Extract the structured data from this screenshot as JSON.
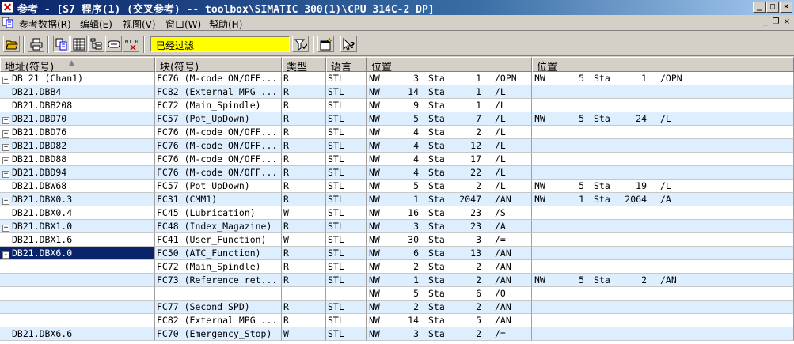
{
  "window": {
    "title": "参考 - [S7 程序(1) (交叉参考) -- toolbox\\SIMATIC 300(1)\\CPU 314C-2 DP]",
    "minimize_label": "_",
    "maximize_label": "□",
    "mdi_minimize_label": "_",
    "mdi_restore_label": "❐",
    "mdi_close_label": "×"
  },
  "menu": [
    {
      "label": "参考数据(R)"
    },
    {
      "label": "编辑(E)"
    },
    {
      "label": "视图(V)"
    },
    {
      "label": "窗口(W)"
    },
    {
      "label": "帮助(H)"
    }
  ],
  "toolbar": {
    "filter_value": "已经过滤",
    "icons": [
      "open-icon",
      "print-icon",
      "cross-reference-icon",
      "assignment-icon",
      "program-structure-icon",
      "unused-symbols-icon",
      "address-without-symbol-icon",
      "filter-icon",
      "new-window-icon",
      "help-icon"
    ]
  },
  "columns": [
    "地址(符号)",
    "块(符号)",
    "类型",
    "语言",
    "位置",
    "位置"
  ],
  "sort_indicator": "▲",
  "rows": [
    {
      "addr": "DB 21 (Chan1)",
      "expand": "+",
      "block": "FC76 (M-code ON/OFF...",
      "type": "R",
      "lang": "STL",
      "loc1": [
        "NW",
        "3",
        "Sta",
        "1",
        "/OPN"
      ],
      "loc2": [
        "NW",
        "5",
        "Sta",
        "1",
        "/OPN"
      ],
      "alt": false,
      "selected": false
    },
    {
      "addr": "DB21.DBB4",
      "expand": "",
      "block": "FC82 (External MPG ...",
      "type": "R",
      "lang": "STL",
      "loc1": [
        "NW",
        "14",
        "Sta",
        "1",
        "/L"
      ],
      "loc2": null,
      "alt": true,
      "selected": false
    },
    {
      "addr": "DB21.DBB208",
      "expand": "",
      "block": "FC72 (Main_Spindle)",
      "type": "R",
      "lang": "STL",
      "loc1": [
        "NW",
        "9",
        "Sta",
        "1",
        "/L"
      ],
      "loc2": null,
      "alt": false,
      "selected": false
    },
    {
      "addr": "DB21.DBD70",
      "expand": "+",
      "block": "FC57 (Pot_UpDown)",
      "type": "R",
      "lang": "STL",
      "loc1": [
        "NW",
        "5",
        "Sta",
        "7",
        "/L"
      ],
      "loc2": [
        "NW",
        "5",
        "Sta",
        "24",
        "/L"
      ],
      "alt": true,
      "selected": false
    },
    {
      "addr": "DB21.DBD76",
      "expand": "+",
      "block": "FC76 (M-code ON/OFF...",
      "type": "R",
      "lang": "STL",
      "loc1": [
        "NW",
        "4",
        "Sta",
        "2",
        "/L"
      ],
      "loc2": null,
      "alt": false,
      "selected": false
    },
    {
      "addr": "DB21.DBD82",
      "expand": "+",
      "block": "FC76 (M-code ON/OFF...",
      "type": "R",
      "lang": "STL",
      "loc1": [
        "NW",
        "4",
        "Sta",
        "12",
        "/L"
      ],
      "loc2": null,
      "alt": true,
      "selected": false
    },
    {
      "addr": "DB21.DBD88",
      "expand": "+",
      "block": "FC76 (M-code ON/OFF...",
      "type": "R",
      "lang": "STL",
      "loc1": [
        "NW",
        "4",
        "Sta",
        "17",
        "/L"
      ],
      "loc2": null,
      "alt": false,
      "selected": false
    },
    {
      "addr": "DB21.DBD94",
      "expand": "+",
      "block": "FC76 (M-code ON/OFF...",
      "type": "R",
      "lang": "STL",
      "loc1": [
        "NW",
        "4",
        "Sta",
        "22",
        "/L"
      ],
      "loc2": null,
      "alt": true,
      "selected": false
    },
    {
      "addr": "DB21.DBW68",
      "expand": "",
      "block": "FC57 (Pot_UpDown)",
      "type": "R",
      "lang": "STL",
      "loc1": [
        "NW",
        "5",
        "Sta",
        "2",
        "/L"
      ],
      "loc2": [
        "NW",
        "5",
        "Sta",
        "19",
        "/L"
      ],
      "alt": false,
      "selected": false
    },
    {
      "addr": "DB21.DBX0.3",
      "expand": "+",
      "block": "FC31 (CMM1)",
      "type": "R",
      "lang": "STL",
      "loc1": [
        "NW",
        "1",
        "Sta",
        "2047",
        "/AN"
      ],
      "loc2": [
        "NW",
        "1",
        "Sta",
        "2064",
        "/A"
      ],
      "alt": true,
      "selected": false
    },
    {
      "addr": "DB21.DBX0.4",
      "expand": "",
      "block": "FC45 (Lubrication)",
      "type": "W",
      "lang": "STL",
      "loc1": [
        "NW",
        "16",
        "Sta",
        "23",
        "/S"
      ],
      "loc2": null,
      "alt": false,
      "selected": false
    },
    {
      "addr": "DB21.DBX1.0",
      "expand": "+",
      "block": "FC48 (Index_Magazine)",
      "type": "R",
      "lang": "STL",
      "loc1": [
        "NW",
        "3",
        "Sta",
        "23",
        "/A"
      ],
      "loc2": null,
      "alt": true,
      "selected": false
    },
    {
      "addr": "DB21.DBX1.6",
      "expand": "",
      "block": "FC41 (User_Function)",
      "type": "W",
      "lang": "STL",
      "loc1": [
        "NW",
        "30",
        "Sta",
        "3",
        "/="
      ],
      "loc2": null,
      "alt": false,
      "selected": false
    },
    {
      "addr": "DB21.DBX6.0",
      "expand": "-",
      "block": "FC50 (ATC_Function)",
      "type": "R",
      "lang": "STL",
      "loc1": [
        "NW",
        "6",
        "Sta",
        "13",
        "/AN"
      ],
      "loc2": null,
      "alt": true,
      "selected": true
    },
    {
      "addr": "",
      "expand": "",
      "block": "FC72 (Main_Spindle)",
      "type": "R",
      "lang": "STL",
      "loc1": [
        "NW",
        "2",
        "Sta",
        "2",
        "/AN"
      ],
      "loc2": null,
      "alt": false,
      "selected": false
    },
    {
      "addr": "",
      "expand": "",
      "block": "FC73 (Reference ret...",
      "type": "R",
      "lang": "STL",
      "loc1": [
        "NW",
        "1",
        "Sta",
        "2",
        "/AN"
      ],
      "loc2": [
        "NW",
        "5",
        "Sta",
        "2",
        "/AN"
      ],
      "alt": true,
      "selected": false
    },
    {
      "addr": "",
      "expand": "",
      "block": "",
      "type": "",
      "lang": "",
      "loc1": [
        "NW",
        "5",
        "Sta",
        "6",
        "/O"
      ],
      "loc2": null,
      "alt": false,
      "selected": false
    },
    {
      "addr": "",
      "expand": "",
      "block": "FC77 (Second_SPD)",
      "type": "R",
      "lang": "STL",
      "loc1": [
        "NW",
        "2",
        "Sta",
        "2",
        "/AN"
      ],
      "loc2": null,
      "alt": true,
      "selected": false
    },
    {
      "addr": "",
      "expand": "",
      "block": "FC82 (External MPG ...",
      "type": "R",
      "lang": "STL",
      "loc1": [
        "NW",
        "14",
        "Sta",
        "5",
        "/AN"
      ],
      "loc2": null,
      "alt": false,
      "selected": false
    },
    {
      "addr": "DB21.DBX6.6",
      "expand": "",
      "block": "FC70 (Emergency_Stop)",
      "type": "W",
      "lang": "STL",
      "loc1": [
        "NW",
        "3",
        "Sta",
        "2",
        "/="
      ],
      "loc2": null,
      "alt": true,
      "selected": false
    }
  ]
}
